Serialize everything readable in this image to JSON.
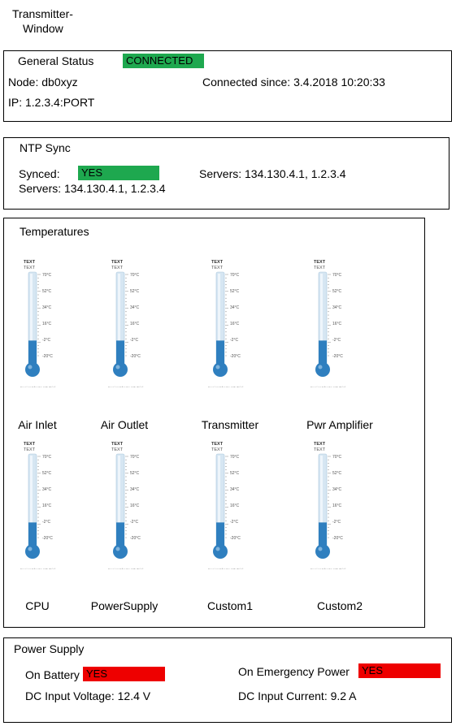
{
  "window": {
    "title_line1": "Transmitter-",
    "title_line2": "Window"
  },
  "general_status": {
    "title": "General Status",
    "status": "CONNECTED",
    "node": "Node: db0xyz",
    "ip": "IP: 1.2.3.4:PORT",
    "connected_since": "Connected since: 3.4.2018 10:20:33",
    "status_color": "#1ea84f"
  },
  "ntp_sync": {
    "title": "NTP Sync",
    "synced_label": "Synced:",
    "synced_value": "YES",
    "servers_left": "Servers: 134.130.4.1, 1.2.3.4",
    "servers_right": "Servers: 134.130.4.1, 1.2.3.4"
  },
  "temperatures": {
    "title": "Temperatures",
    "gauge_header1": "TEXT",
    "gauge_header2": "TEXT",
    "scale": [
      "70°C",
      "52°C",
      "34°C",
      "16°C",
      "-2°C",
      "-20°C"
    ],
    "watermark": "FusionCharts XT Trial",
    "sensors": [
      {
        "label": "Air Inlet",
        "fill": 0.1
      },
      {
        "label": "Air Outlet",
        "fill": 0.1
      },
      {
        "label": "Transmitter",
        "fill": 0.1
      },
      {
        "label": "Pwr Amplifier",
        "fill": 0.1
      },
      {
        "label": "CPU",
        "fill": 0.1
      },
      {
        "label": "PowerSupply",
        "fill": 0.1
      },
      {
        "label": "Custom1",
        "fill": 0.1
      },
      {
        "label": "Custom2",
        "fill": 0.1
      }
    ],
    "colors": {
      "tube": "#d6e6f2",
      "liquid": "#2f7fbf"
    }
  },
  "power_supply": {
    "title": "Power Supply",
    "on_battery_label": "On Battery",
    "on_battery_value": "YES",
    "on_emergency_label": "On Emergency Power",
    "on_emergency_value": "YES",
    "dc_voltage": "DC Input Voltage: 12.4 V",
    "dc_current": "DC Input Current: 9.2 A",
    "alert_color": "#ee0000"
  }
}
